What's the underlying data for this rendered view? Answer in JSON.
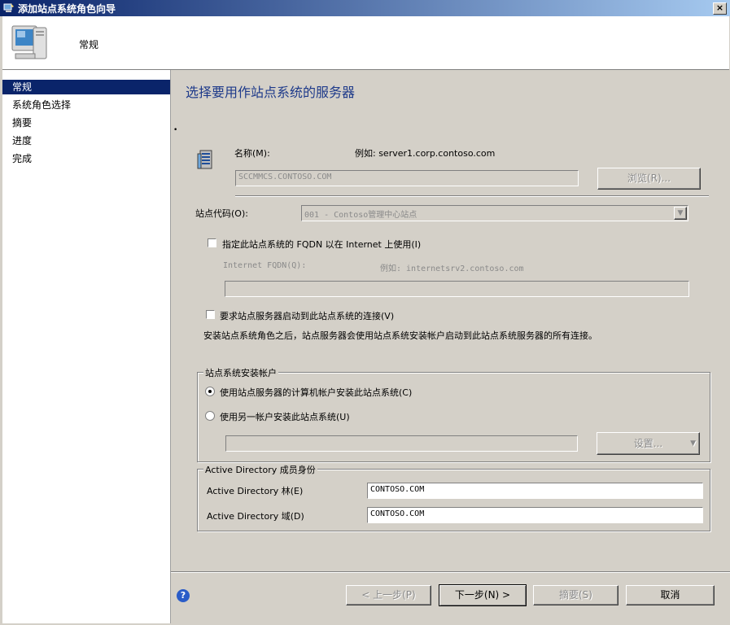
{
  "window": {
    "title": "添加站点系统角色向导",
    "close_label": "×"
  },
  "header": {
    "title": "常规"
  },
  "nav": {
    "items": [
      {
        "label": "常规",
        "selected": true
      },
      {
        "label": "系统角色选择"
      },
      {
        "label": "摘要"
      },
      {
        "label": "进度"
      },
      {
        "label": "完成"
      }
    ]
  },
  "main": {
    "title": "选择要用作站点系统的服务器",
    "dot": "•",
    "name_label": "名称(M):",
    "name_example": "例如: server1.corp.contoso.com",
    "name_value": "SCCMMCS.CONTOSO.COM",
    "browse_label": "浏览(R)...",
    "site_code_label": "站点代码(O):",
    "site_code_value": "001 - Contoso管理中心站点",
    "fqdn_check_label": "指定此站点系统的 FQDN 以在 Internet 上使用(I)",
    "internet_fqdn_label": "Internet FQDN(Q):",
    "internet_fqdn_example": "例如: internetsrv2.contoso.com",
    "internet_fqdn_value": "",
    "require_check_label": "要求站点服务器启动到此站点系统的连接(V)",
    "info_text": "安装站点系统角色之后，站点服务器会使用站点系统安装帐户启动到此站点系统服务器的所有连接。",
    "install_group": {
      "title": "站点系统安装帐户",
      "radio1": "使用站点服务器的计算机帐户安装此站点系统(C)",
      "radio2": "使用另一帐户安装此站点系统(U)",
      "account_value": "",
      "settings_label": "设置..."
    },
    "ad_group": {
      "title": "Active Directory 成员身份",
      "forest_label": "Active Directory 林(E)",
      "forest_value": "CONTOSO.COM",
      "domain_label": "Active Directory 域(D)",
      "domain_value": "CONTOSO.COM"
    }
  },
  "footer": {
    "help_label": "?",
    "prev_label": "< 上一步(P)",
    "next_label": "下一步(N) >",
    "summary_label": "摘要(S)",
    "cancel_label": "取消"
  }
}
